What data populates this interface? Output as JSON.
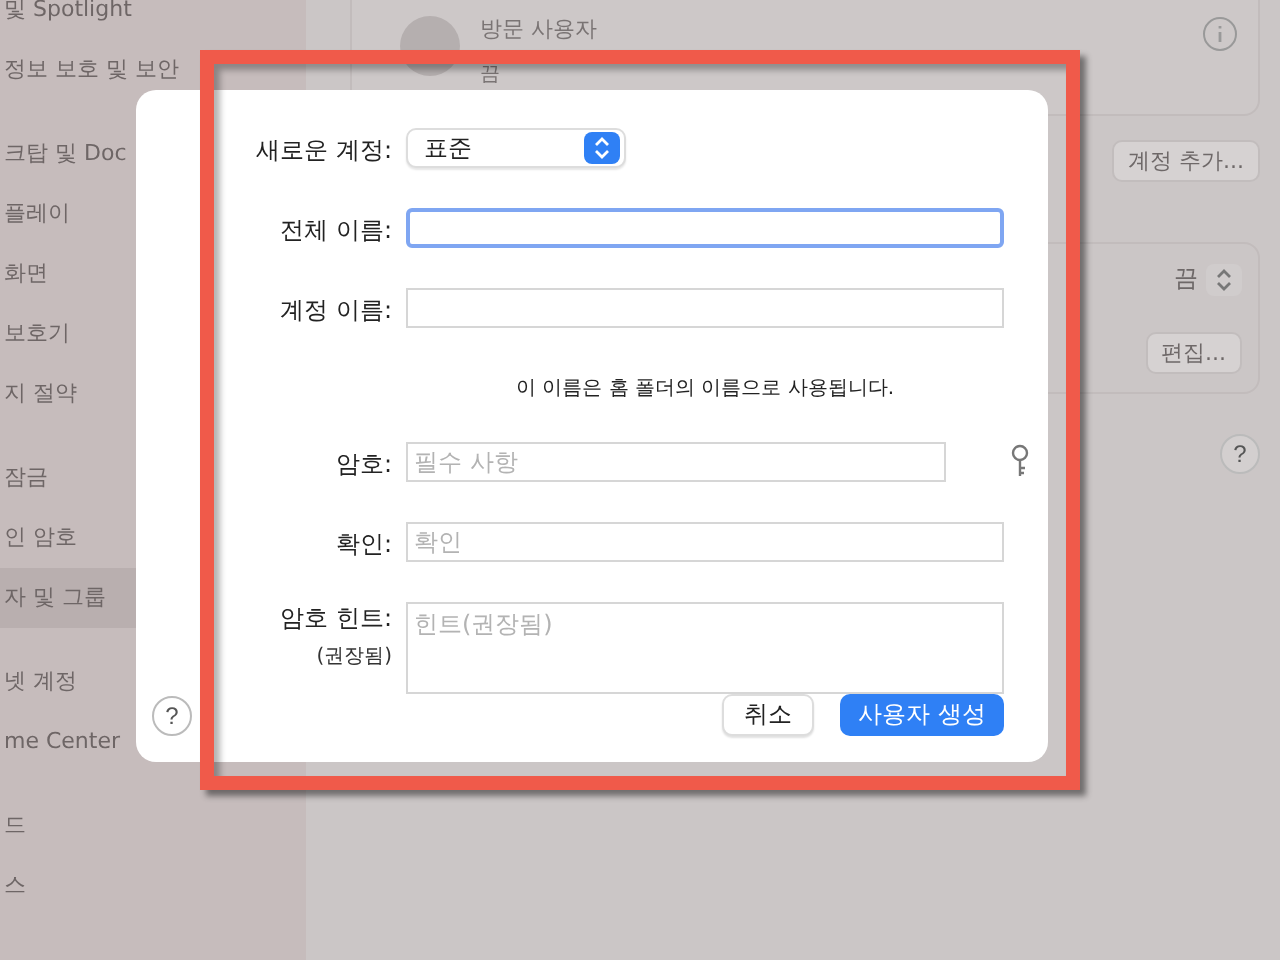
{
  "sidebar": {
    "items": [
      {
        "label": "및 Spotlight",
        "selected": false
      },
      {
        "label": "정보 보호 및 보안",
        "selected": false
      },
      {
        "label": "크탑 및 Doc",
        "selected": false
      },
      {
        "label": "플레이",
        "selected": false
      },
      {
        "label": "화면",
        "selected": false
      },
      {
        "label": "보호기",
        "selected": false
      },
      {
        "label": "지 절약",
        "selected": false
      },
      {
        "label": "잠금",
        "selected": false
      },
      {
        "label": "인 암호",
        "selected": false
      },
      {
        "label": "자 및 그룹",
        "selected": true
      },
      {
        "label": "넷 계정",
        "selected": false
      },
      {
        "label": "me Center",
        "selected": false
      },
      {
        "label": "드",
        "selected": false
      },
      {
        "label": "스",
        "selected": false
      }
    ]
  },
  "content": {
    "guest": {
      "name": "방문 사용자",
      "status": "끔"
    },
    "add_account_button": "계정 추가...",
    "setting_value": "끔",
    "edit_button": "편집...",
    "help": "?"
  },
  "dialog": {
    "account_type": {
      "label": "새로운 계정:",
      "value": "표준"
    },
    "fields": [
      {
        "kind": "text",
        "label": "전체 이름:",
        "focused": true
      },
      {
        "kind": "text",
        "label": "계정 이름:",
        "focused": false,
        "note": "이 이름은 홈 폴더의 이름으로 사용됩니다."
      },
      {
        "kind": "password",
        "label": "암호:",
        "placeholder": "필수 사항",
        "focused": false
      },
      {
        "kind": "text",
        "label": "확인:",
        "placeholder": "확인",
        "focused": false
      },
      {
        "kind": "hint",
        "label": "암호 힌트:",
        "sublabel": "(권장됨)",
        "placeholder": "힌트(권장됨)",
        "focused": false
      }
    ],
    "help": "?",
    "cancel_button": "취소",
    "create_button": "사용자 생성"
  }
}
